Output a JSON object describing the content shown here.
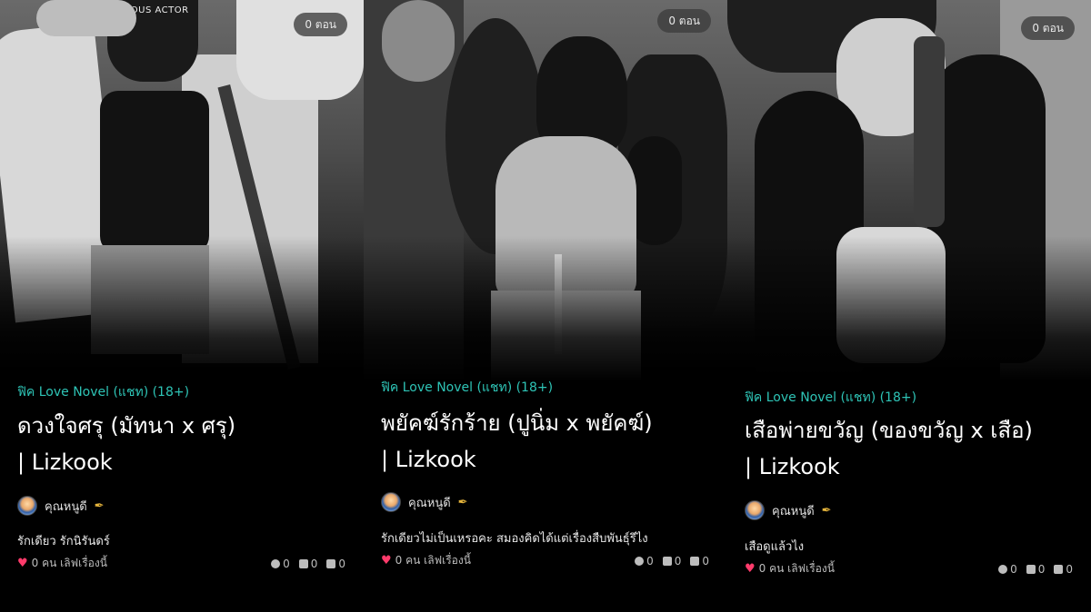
{
  "cards": [
    {
      "episodes": "0 ตอน",
      "genre": "ฟิค Love Novel (แชท) (18+)",
      "title_line1": "ดวงใจศรุ (มัทนา x ศรุ)",
      "title_line2": "| Lizkook",
      "author": "คุณหนูดี",
      "description": "รักเดียว รักนิรันดร์",
      "likes": "0 คน เลิฟเรื่องนี้",
      "views": "0",
      "comments": "0",
      "chapters": "0",
      "photo_text": "FAMOUS ACTOR"
    },
    {
      "episodes": "0 ตอน",
      "genre": "ฟิค Love Novel (แชท) (18+)",
      "title_line1": "พยัคฆ์รักร้าย (ปูนิ่ม x พยัคฆ์)",
      "title_line2": "| Lizkook",
      "author": "คุณหนูดี",
      "description": "รักเดียวไม่เป็นเหรอคะ สมองคิดได้แต่เรื่องสืบพันธุ์รึไง",
      "likes": "0 คน เลิฟเรื่องนี้",
      "views": "0",
      "comments": "0",
      "chapters": "0"
    },
    {
      "episodes": "0 ตอน",
      "genre": "ฟิค Love Novel (แชท) (18+)",
      "title_line1": "เสือพ่ายขวัญ (ของขวัญ x เสือ)",
      "title_line2": "| Lizkook",
      "author": "คุณหนูดี",
      "description": "เสือดูแล้วไง",
      "likes": "0 คน เลิฟเรื่องนี้",
      "views": "0",
      "comments": "0",
      "chapters": "0"
    }
  ],
  "colors": {
    "genre": "#2ec4b6",
    "heart": "#ff3b6b",
    "background": "#000000"
  },
  "icons": {
    "pen": "quill-pen-icon",
    "heart": "heart-icon",
    "views": "eye-icon",
    "comments": "comment-icon",
    "chapters": "book-icon"
  }
}
